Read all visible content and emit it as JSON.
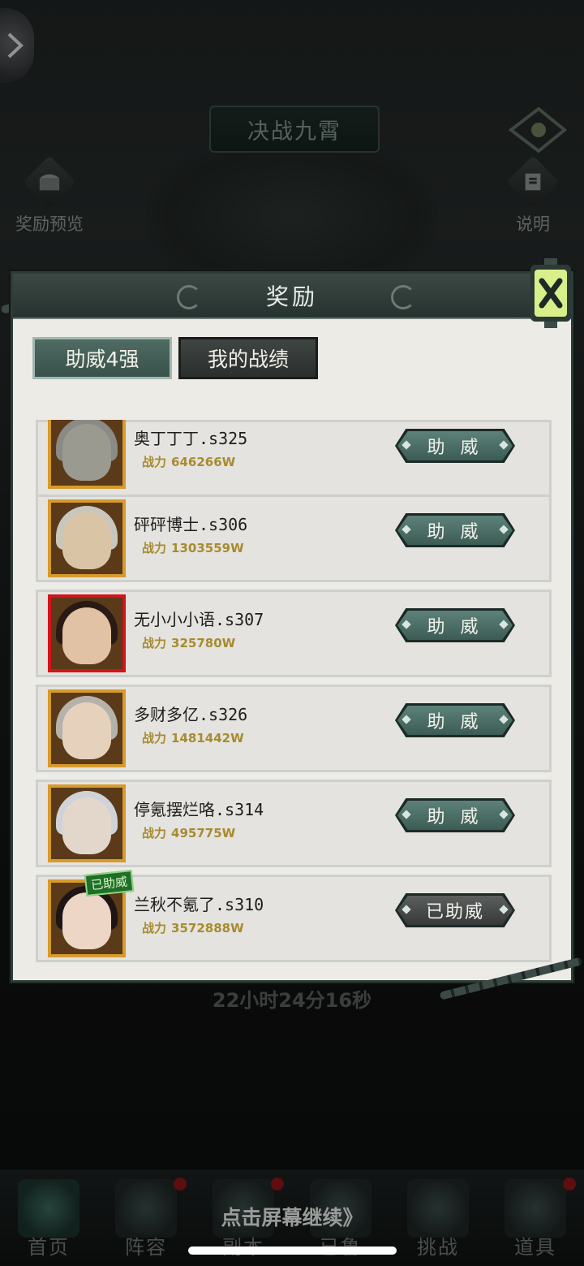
{
  "screen": {
    "title": "决战九霄",
    "left_menu": {
      "label": "奖励预览",
      "icon": "treasure-chest-icon"
    },
    "right_menu": {
      "label": "说明",
      "icon": "scroll-info-icon"
    },
    "timer": "22小时24分16秒",
    "continue_hint": "点击屏幕继续》"
  },
  "dialog": {
    "title": "奖励",
    "close_icon": "close-lantern-icon",
    "tabs": [
      {
        "label": "助威4强",
        "active": true
      },
      {
        "label": "我的战绩",
        "active": false
      }
    ],
    "power_prefix": "战力",
    "rows": [
      {
        "name": "奥丁丁丁.s325",
        "power": "646266W",
        "button": "助 威",
        "helped": false,
        "highlight": false
      },
      {
        "name": "砰砰博士.s306",
        "power": "1303559W",
        "button": "助 威",
        "helped": false,
        "highlight": false
      },
      {
        "name": "无小小小语.s307",
        "power": "325780W",
        "button": "助 威",
        "helped": false,
        "highlight": true
      },
      {
        "name": "多财多亿.s326",
        "power": "1481442W",
        "button": "助 威",
        "helped": false,
        "highlight": false
      },
      {
        "name": "停氪摆烂咯.s314",
        "power": "495775W",
        "button": "助 威",
        "helped": false,
        "highlight": false
      },
      {
        "name": "兰秋不氪了.s310",
        "power": "3572888W",
        "button": "已助威",
        "helped": true,
        "helped_tag": "已助威",
        "highlight": false
      }
    ]
  },
  "bottom_nav": [
    {
      "label": "首页",
      "badge": false
    },
    {
      "label": "阵容",
      "badge": true
    },
    {
      "label": "副本",
      "badge": true
    },
    {
      "label": "已鲁",
      "badge": false
    },
    {
      "label": "挑战",
      "badge": false
    },
    {
      "label": "道具",
      "badge": true
    }
  ],
  "colors": {
    "accent_teal": "#3b5c54",
    "gold": "#d79a2c",
    "highlight_red": "#d4131a",
    "power_text": "#a88b2f"
  }
}
